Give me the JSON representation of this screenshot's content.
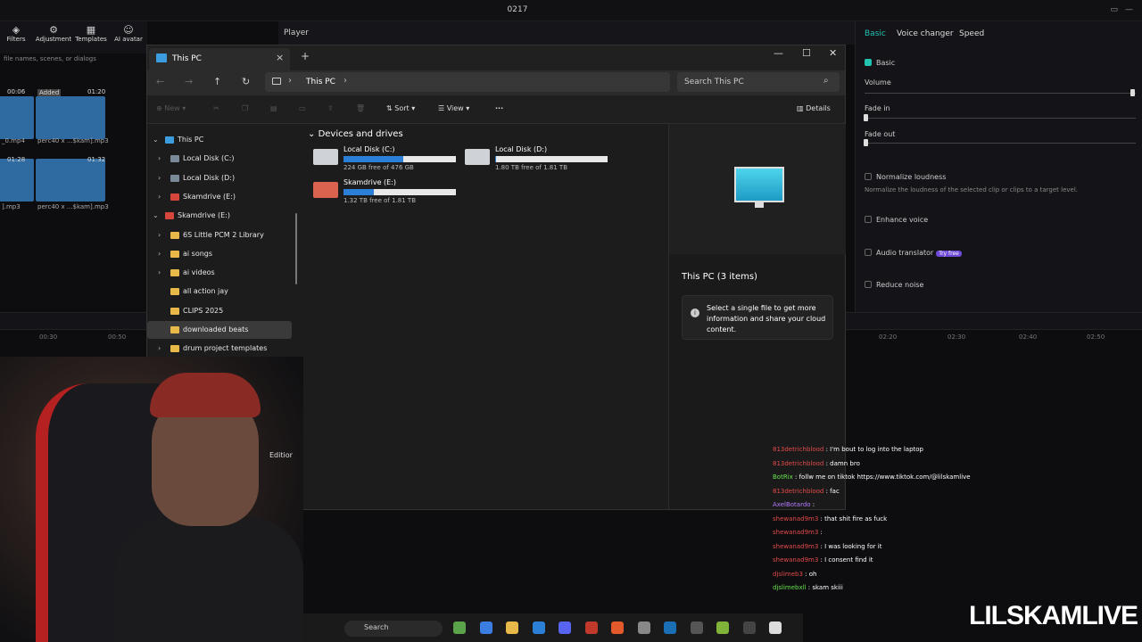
{
  "topbar": {
    "project_title": "0217"
  },
  "editor": {
    "tools": [
      {
        "label": "Filters",
        "icon": "filters-icon"
      },
      {
        "label": "Adjustment",
        "icon": "adjustment-icon"
      },
      {
        "label": "Templates",
        "icon": "templates-icon"
      },
      {
        "label": "AI avatar",
        "icon": "avatar-icon"
      }
    ],
    "search_placeholder": "file names, scenes, or dialogs",
    "clips": [
      {
        "time": "00:06",
        "label": "_0.mp4"
      },
      {
        "badge": "Added",
        "time": "01:20",
        "label": "perc40 x ...$kam].mp3"
      },
      {
        "time": "01:28",
        "label": "].mp3"
      },
      {
        "time": "01:32",
        "label": "perc40 x ...$kam].mp3"
      }
    ]
  },
  "player": {
    "label": "Player"
  },
  "right_panel": {
    "tabs": [
      "Basic",
      "Voice changer",
      "Speed"
    ],
    "section": "Basic",
    "volume": "Volume",
    "fade_in": "Fade in",
    "fade_out": "Fade out",
    "normalize": "Normalize loudness",
    "normalize_desc": "Normalize the loudness of the selected clip or clips to a target level.",
    "enhance": "Enhance voice",
    "translator": "Audio translator",
    "translator_badge": "Try free",
    "reduce": "Reduce noise"
  },
  "timeline": {
    "ticks": [
      "00:30",
      "00:50",
      "02:20",
      "02:30",
      "02:40",
      "02:50"
    ]
  },
  "explorer": {
    "tab_title": "This PC",
    "address": "This PC",
    "search_placeholder": "Search This PC",
    "toolbar": {
      "new": "New",
      "sort": "Sort",
      "view": "View",
      "more": "···",
      "details": "Details"
    },
    "nav": [
      {
        "label": "This PC",
        "level": 0,
        "expanded": true,
        "type": "pc",
        "selected": false
      },
      {
        "label": "Local Disk (C:)",
        "level": 1,
        "expanded": false,
        "type": "drive"
      },
      {
        "label": "Local Disk (D:)",
        "level": 1,
        "expanded": false,
        "type": "drive"
      },
      {
        "label": "Skamdrive (E:)",
        "level": 1,
        "expanded": false,
        "type": "red"
      },
      {
        "label": "Skamdrive (E:)",
        "level": 0,
        "expanded": true,
        "type": "red"
      },
      {
        "label": "6S Little PCM 2 Library",
        "level": 1,
        "expanded": false,
        "type": "folder"
      },
      {
        "label": "ai songs",
        "level": 1,
        "expanded": false,
        "type": "folder"
      },
      {
        "label": "ai videos",
        "level": 1,
        "expanded": false,
        "type": "folder"
      },
      {
        "label": "all action jay",
        "level": 1,
        "noexpand": true,
        "type": "folder"
      },
      {
        "label": "CLIPS 2025",
        "level": 1,
        "noexpand": true,
        "type": "folder"
      },
      {
        "label": "downloaded beats",
        "level": 1,
        "noexpand": true,
        "type": "folder",
        "selected": true
      },
      {
        "label": "drum project templates",
        "level": 1,
        "expanded": false,
        "type": "folder"
      }
    ],
    "section_header": "Devices and drives",
    "drives": [
      {
        "name": "Local Disk (C:)",
        "free": "224 GB free of 476 GB",
        "used_fraction": 0.53
      },
      {
        "name": "Local Disk (D:)",
        "free": "1.80 TB free of 1.81 TB",
        "used_fraction": 0.01
      },
      {
        "name": "Skamdrive (E:)",
        "free": "1.32 TB free of 1.81 TB",
        "used_fraction": 0.27
      }
    ],
    "details_title": "This PC (3 items)",
    "details_info": "Select a single file to get more information and share your cloud content."
  },
  "stream": {
    "editor_label": "Editior",
    "brand": "LILSKAMLIVE",
    "chat": [
      {
        "user": "813detrichblood",
        "text": ": I'm bout to log into the laptop",
        "cls": "r"
      },
      {
        "user": "813detrichblood",
        "text": ": damn bro",
        "cls": "r"
      },
      {
        "user": "BotRix",
        "text": ": follw me on tiktok https://www.tiktok.com/@lilskamlive",
        "cls": "g"
      },
      {
        "user": "813detrichblood",
        "text": ": fac",
        "cls": "r"
      },
      {
        "user": "AxelBotardo",
        "text": ":",
        "cls": "p"
      },
      {
        "user": "shewanad9m3",
        "text": ": that shit fire as fuck",
        "cls": "r"
      },
      {
        "user": "shewanad9m3",
        "text": ":",
        "cls": "r"
      },
      {
        "user": "shewanad9m3",
        "text": ": I was looking for it",
        "cls": "r"
      },
      {
        "user": "shewanad9m3",
        "text": ": I consent find it",
        "cls": "r"
      },
      {
        "user": "djslimeb3",
        "text": ": oh",
        "cls": "r"
      },
      {
        "user": "djslimebxll",
        "text": ": skam skiii",
        "cls": "g"
      }
    ],
    "taskbar_search": "Search"
  }
}
